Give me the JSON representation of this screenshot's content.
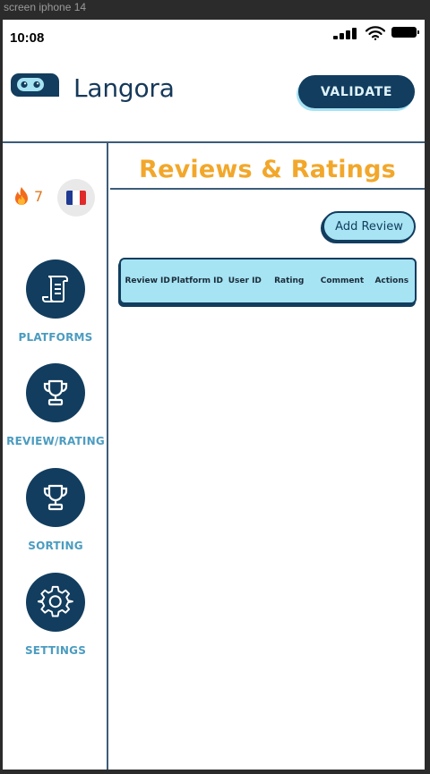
{
  "frame_label": "screen iphone 14",
  "status_bar": {
    "time": "10:08"
  },
  "header": {
    "brand": "Langora",
    "validate_label": "VALIDATE"
  },
  "sidebar": {
    "streak_count": "7",
    "flag": {
      "colors": [
        "#1f3a93",
        "#ffffff",
        "#e02a2a"
      ]
    },
    "nav": [
      {
        "label": "PLATFORMS",
        "icon": "scroll-icon"
      },
      {
        "label": "REVIEW/RATING",
        "icon": "trophy-icon"
      },
      {
        "label": "SORTING",
        "icon": "trophy-icon"
      },
      {
        "label": "SETTINGS",
        "icon": "gear-icon"
      }
    ]
  },
  "main": {
    "title": "Reviews & Ratings",
    "add_review_label": "Add Review",
    "table": {
      "columns": [
        "Review ID",
        "Platform ID",
        "User ID",
        "Rating",
        "Comment",
        "Actions"
      ]
    }
  },
  "colors": {
    "primary": "#123d5e",
    "accent": "#f2a72b",
    "light": "#a6e3f3",
    "nav_label": "#4b9cc0"
  }
}
